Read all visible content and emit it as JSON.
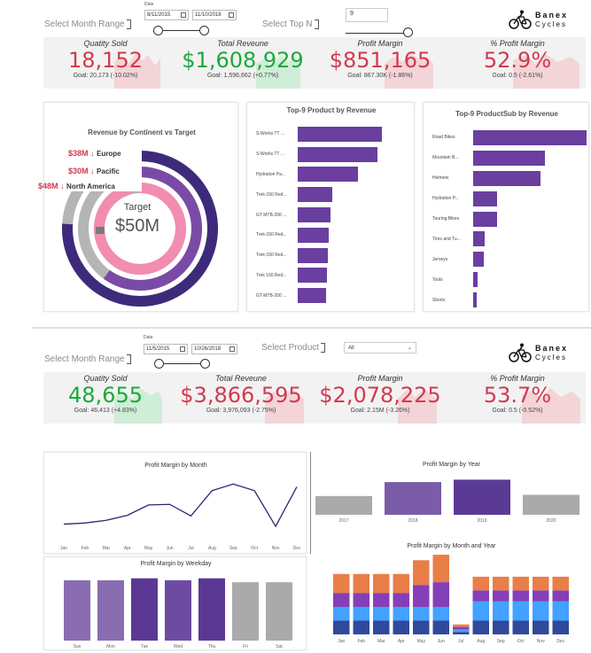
{
  "section1": {
    "date_label": "Date",
    "month_range_label": "Select Month Range",
    "start_date": "8/11/2015",
    "end_date": "11/10/2018",
    "top_n_label": "Select Top N",
    "top_n_value": "9",
    "logo": {
      "line1": "Banex",
      "line2": "Cycles"
    },
    "kpis": [
      {
        "title": "Quatity Sold",
        "value": "18,152",
        "goal": "Goal: 20,173 (-10.02%)",
        "status": "red"
      },
      {
        "title": "Total Reveune",
        "value": "$1,608,929",
        "goal": "Goal: 1,596,662 (+0.77%)",
        "status": "green"
      },
      {
        "title": "Profit Margin",
        "value": "$851,165",
        "goal": "Goal: 867.30K (-1.86%)",
        "status": "red"
      },
      {
        "title": "% Profit Margin",
        "value": "52.9%",
        "goal": "Goal: 0.5 (-2.61%)",
        "status": "red"
      }
    ],
    "radial": {
      "title": "Revenue by Continent vs Target",
      "rings": [
        {
          "value": "$38M",
          "name": "Europe",
          "fraction": 0.76,
          "color": "#3d2a7a"
        },
        {
          "value": "$30M",
          "name": "Pacific",
          "fraction": 0.6,
          "color": "#7a4ba6"
        },
        {
          "value": "$48M",
          "name": "North America",
          "fraction": 0.96,
          "color": "#f28cb1"
        }
      ],
      "target_label": "Target",
      "target_value": "$50M"
    },
    "top_products": {
      "title": "Top-9 Product by Revenue",
      "items": [
        {
          "label": "S-Works TT ...",
          "value": 0.95
        },
        {
          "label": "S-Works TT ...",
          "value": 0.9
        },
        {
          "label": "Hydration Pa...",
          "value": 0.68
        },
        {
          "label": "Trek-150 Red...",
          "value": 0.39
        },
        {
          "label": "GT MTB-200 ...",
          "value": 0.37
        },
        {
          "label": "Trek-150 Red...",
          "value": 0.35
        },
        {
          "label": "Trek-150 Red...",
          "value": 0.34
        },
        {
          "label": "Trek 150 Red...",
          "value": 0.33
        },
        {
          "label": "GT MTB-200 ...",
          "value": 0.32
        }
      ]
    },
    "top_subcats": {
      "title": "Top-9 ProductSub by Revenue",
      "items": [
        {
          "label": "Road Bikes",
          "value": 1.0
        },
        {
          "label": "Mountain B...",
          "value": 0.63
        },
        {
          "label": "Helmets",
          "value": 0.59
        },
        {
          "label": "Hydration P...",
          "value": 0.21
        },
        {
          "label": "Touring Bikes",
          "value": 0.21
        },
        {
          "label": "Tires and Tu...",
          "value": 0.1
        },
        {
          "label": "Jerseys",
          "value": 0.09
        },
        {
          "label": "Tools",
          "value": 0.04
        },
        {
          "label": "Shorts",
          "value": 0.03
        }
      ]
    }
  },
  "section2": {
    "date_label": "Date",
    "month_range_label": "Select Month Range",
    "start_date": "11/5/2015",
    "end_date": "10/26/2018",
    "product_label": "Select Product",
    "product_value": "All",
    "logo": {
      "line1": "Banex",
      "line2": "Cycles"
    },
    "kpis": [
      {
        "title": "Quatity Sold",
        "value": "48,655",
        "goal": "Goal: 46,413 (+4.83%)",
        "status": "green"
      },
      {
        "title": "Total Reveune",
        "value": "$3,866,595",
        "goal": "Goal: 3,976,093 (-2.75%)",
        "status": "red"
      },
      {
        "title": "Profit Margin",
        "value": "$2,078,225",
        "goal": "Goal: 2.15M (-3.26%)",
        "status": "red"
      },
      {
        "title": "% Profit Margin",
        "value": "53.7%",
        "goal": "Goal: 0.5 (-0.52%)",
        "status": "red"
      }
    ],
    "pm_month": {
      "title": "Profit Margin by Month",
      "categories": [
        "Jan",
        "Feb",
        "Mar",
        "Apr",
        "May",
        "Jun",
        "Jul",
        "Aug",
        "Sep",
        "Oct",
        "Nov",
        "Dec"
      ],
      "values": [
        0.12,
        0.14,
        0.19,
        0.28,
        0.47,
        0.48,
        0.27,
        0.73,
        0.85,
        0.73,
        0.08,
        0.8
      ]
    },
    "pm_year": {
      "title": "Profit Margin by Year",
      "categories": [
        "2017",
        "2018",
        "2019",
        "2020"
      ],
      "values": [
        0.47,
        0.82,
        0.88,
        0.5
      ],
      "colors": [
        "#aaaaaa",
        "#7a5ca8",
        "#5a3a94",
        "#aaaaaa"
      ]
    },
    "pm_weekday": {
      "title": "Profit Margin by Weekday",
      "categories": [
        "Sun",
        "Mon",
        "Tue",
        "Wed",
        "Thu",
        "Fri",
        "Sat"
      ],
      "values": [
        0.92,
        0.92,
        0.95,
        0.92,
        0.95,
        0.89,
        0.89
      ],
      "colors": [
        "#8a6cb3",
        "#8a6cb3",
        "#5b3894",
        "#6e4ba3",
        "#5b3894",
        "#aaaaaa",
        "#aaaaaa"
      ]
    },
    "pm_month_year": {
      "title": "Profit Margin by Month and Year",
      "categories": [
        "Jan",
        "Feb",
        "Mar",
        "Apr",
        "May",
        "Jun",
        "Jul",
        "Aug",
        "Sep",
        "Oct",
        "Nov",
        "Dec"
      ]
    }
  }
}
